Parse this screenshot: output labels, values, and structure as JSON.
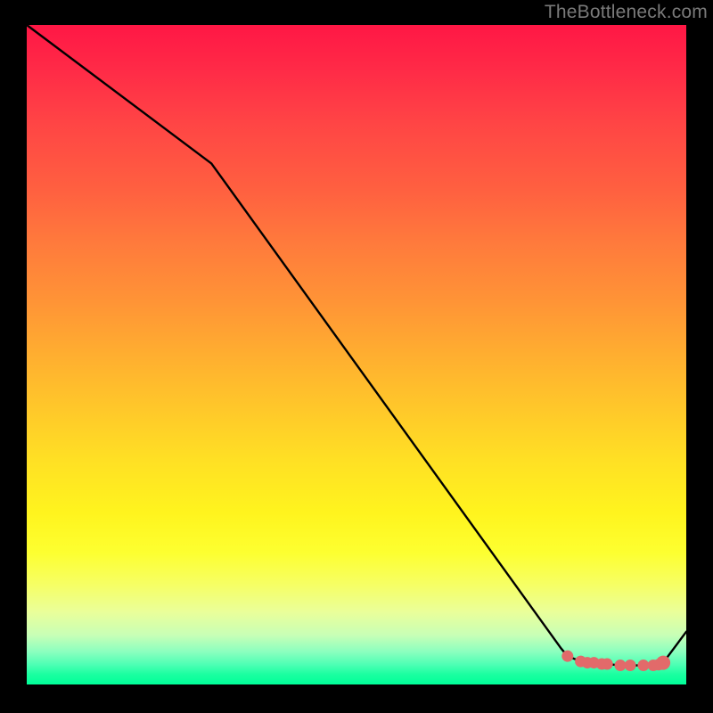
{
  "watermark": "TheBottleneck.com",
  "chart_data": {
    "type": "line",
    "title": "",
    "xlabel": "",
    "ylabel": "",
    "xlim": [
      0,
      100
    ],
    "ylim": [
      0,
      100
    ],
    "series": [
      {
        "name": "curve",
        "x": [
          0,
          28,
          81,
          82,
          84,
          85,
          86,
          87.2,
          88,
          90,
          91.5,
          93.5,
          95,
          95.8,
          96,
          96.5,
          100
        ],
        "values": [
          100,
          79,
          5.5,
          4.3,
          3.5,
          3.3,
          3.3,
          3.1,
          3.1,
          2.9,
          2.9,
          2.9,
          2.9,
          3.0,
          3.1,
          3.3,
          8
        ],
        "color": "#000000",
        "line_width": 2.4
      }
    ],
    "markers": [
      {
        "shape": "circle",
        "x": 82,
        "y": 4.3,
        "size": 6.5,
        "color": "#e26a6a"
      },
      {
        "shape": "circle",
        "x": 84,
        "y": 3.5,
        "size": 6.5,
        "color": "#e26a6a"
      },
      {
        "shape": "circle",
        "x": 85,
        "y": 3.3,
        "size": 6.5,
        "color": "#e26a6a"
      },
      {
        "shape": "circle",
        "x": 86,
        "y": 3.3,
        "size": 6.5,
        "color": "#e26a6a"
      },
      {
        "shape": "circle",
        "x": 87.2,
        "y": 3.1,
        "size": 6.5,
        "color": "#e26a6a"
      },
      {
        "shape": "circle",
        "x": 88,
        "y": 3.1,
        "size": 6.5,
        "color": "#e26a6a"
      },
      {
        "shape": "circle",
        "x": 90,
        "y": 2.9,
        "size": 6.5,
        "color": "#e26a6a"
      },
      {
        "shape": "circle",
        "x": 91.5,
        "y": 2.9,
        "size": 6.5,
        "color": "#e26a6a"
      },
      {
        "shape": "circle",
        "x": 93.5,
        "y": 2.9,
        "size": 6.5,
        "color": "#e26a6a"
      },
      {
        "shape": "circle",
        "x": 95,
        "y": 2.9,
        "size": 6.5,
        "color": "#e26a6a"
      },
      {
        "shape": "circle",
        "x": 95.8,
        "y": 3.0,
        "size": 6.5,
        "color": "#e26a6a"
      },
      {
        "shape": "circle",
        "x": 96.5,
        "y": 3.3,
        "size": 8.0,
        "color": "#e26a6a"
      }
    ]
  }
}
